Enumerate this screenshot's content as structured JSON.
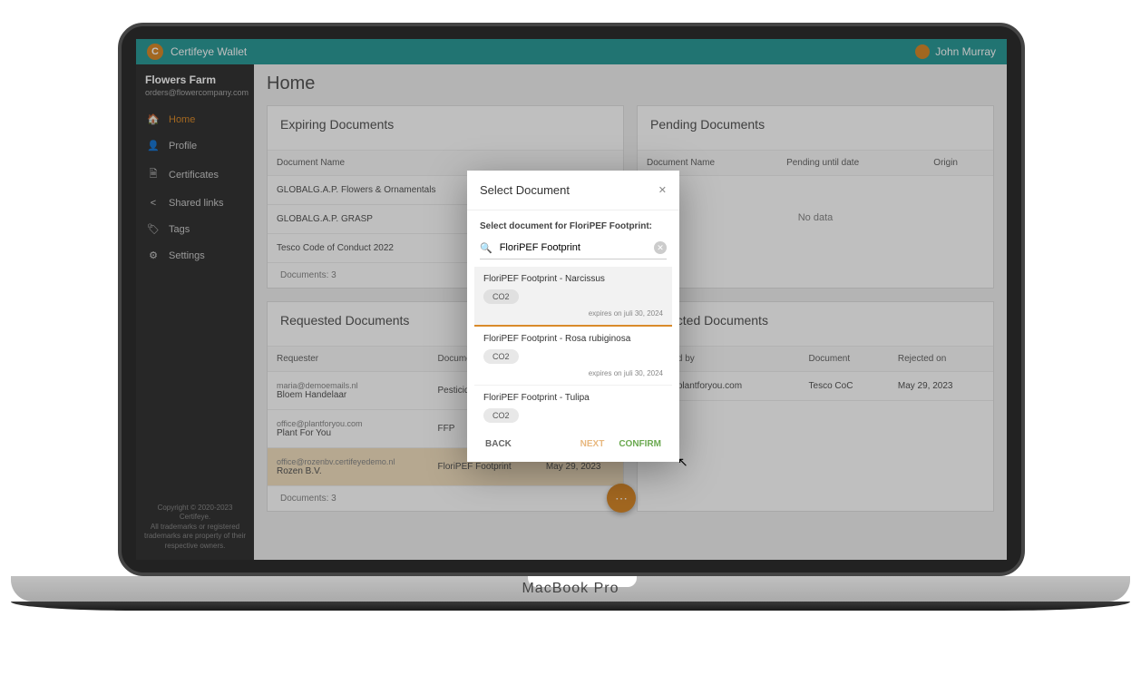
{
  "topbar": {
    "app_name": "Certifeye Wallet",
    "user_name": "John Murray"
  },
  "sidebar": {
    "company": "Flowers Farm",
    "company_email": "orders@flowercompany.com",
    "items": [
      {
        "id": "home",
        "label": "Home",
        "icon": "home-icon"
      },
      {
        "id": "profile",
        "label": "Profile",
        "icon": "person-icon"
      },
      {
        "id": "certificates",
        "label": "Certificates",
        "icon": "document-icon"
      },
      {
        "id": "shared-links",
        "label": "Shared links",
        "icon": "share-icon"
      },
      {
        "id": "tags",
        "label": "Tags",
        "icon": "tag-icon"
      },
      {
        "id": "settings",
        "label": "Settings",
        "icon": "gear-icon"
      }
    ],
    "footer_line1": "Copyright © 2020-2023 Certifeye.",
    "footer_line2": "All trademarks or registered trademarks are property of their respective owners."
  },
  "page": {
    "title": "Home"
  },
  "expiring": {
    "title": "Expiring Documents",
    "header_docname": "Document Name",
    "rows": [
      {
        "name": "GLOBALG.A.P. Flowers & Ornamentals"
      },
      {
        "name": "GLOBALG.A.P. GRASP"
      },
      {
        "name": "Tesco Code of Conduct 2022"
      }
    ],
    "footer_count": "Documents: 3"
  },
  "pending": {
    "title": "Pending Documents",
    "headers": {
      "docname": "Document Name",
      "pending_until": "Pending until date",
      "origin": "Origin"
    },
    "nodata": "No data"
  },
  "requested": {
    "title": "Requested Documents",
    "headers": {
      "requester": "Requester",
      "document": "Document",
      "date": ""
    },
    "rows": [
      {
        "email": "maria@demoemails.nl",
        "name": "Bloem Handelaar",
        "document": "Pesticide list",
        "date": ""
      },
      {
        "email": "office@plantforyou.com",
        "name": "Plant For You",
        "document": "FFP",
        "date": ""
      },
      {
        "email": "office@rozenbv.certifeyedemo.nl",
        "name": "Rozen B.V.",
        "document": "FloriPEF Footprint",
        "date": "May 29, 2023",
        "selected": true
      }
    ],
    "footer_count": "Documents: 3"
  },
  "rejected": {
    "title": "Rejected Documents",
    "headers": {
      "by": "Rejected by",
      "document": "Document",
      "on": "Rejected on"
    },
    "rows": [
      {
        "email": "office@plantforyou.com",
        "document": "Tesco CoC",
        "on": "May 29, 2023"
      }
    ]
  },
  "dialog": {
    "title": "Select Document",
    "subtitle": "Select document for FloriPEF Footprint:",
    "search_value": "FloriPEF Footprint",
    "items": [
      {
        "name": "FloriPEF Footprint - Narcissus",
        "tag": "CO2",
        "expires": "expires on juli 30, 2024",
        "selected": true
      },
      {
        "name": "FloriPEF Footprint - Rosa rubiginosa",
        "tag": "CO2",
        "expires": "expires on juli 30, 2024"
      },
      {
        "name": "FloriPEF Footprint - Tulipa",
        "tag": "CO2",
        "expires": ""
      }
    ],
    "back": "BACK",
    "next": "NEXT",
    "confirm": "CONFIRM"
  },
  "laptop_text": "MacBook Pro"
}
